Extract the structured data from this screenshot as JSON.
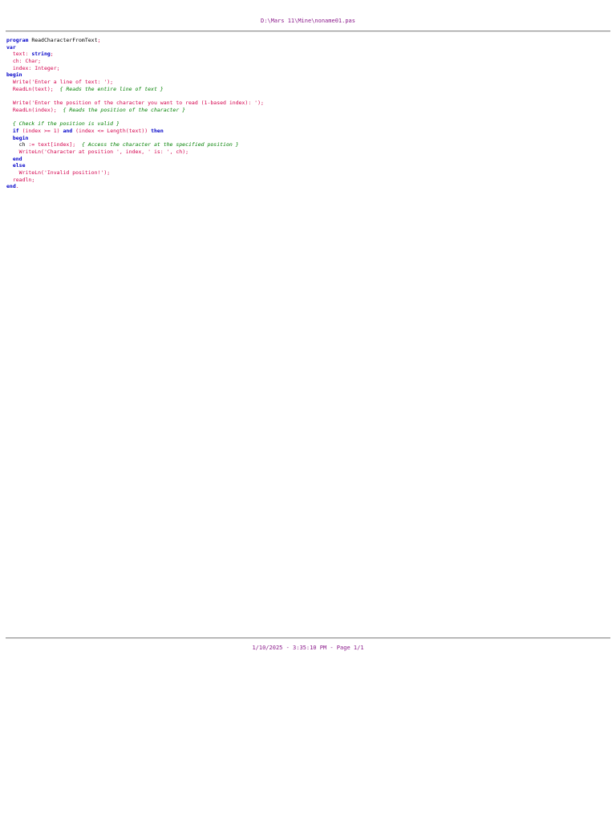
{
  "header": {
    "file_path": "D:\\Mars 11\\Mine\\noname01.pas"
  },
  "code": {
    "lines": [
      [
        {
          "t": "program",
          "c": "kw"
        },
        {
          "t": " ReadCharacterFromText",
          "c": "id"
        },
        {
          "t": ";",
          "c": "sym"
        }
      ],
      [
        {
          "t": "var",
          "c": "kw"
        }
      ],
      [
        {
          "t": "  text",
          "c": "var"
        },
        {
          "t": ": ",
          "c": "sym"
        },
        {
          "t": "string",
          "c": "kw"
        },
        {
          "t": ";",
          "c": "sym"
        }
      ],
      [
        {
          "t": "  ch",
          "c": "var"
        },
        {
          "t": ": ",
          "c": "sym"
        },
        {
          "t": "Char",
          "c": "fn"
        },
        {
          "t": ";",
          "c": "sym"
        }
      ],
      [
        {
          "t": "  index",
          "c": "var"
        },
        {
          "t": ": ",
          "c": "sym"
        },
        {
          "t": "Integer",
          "c": "fn"
        },
        {
          "t": ";",
          "c": "sym"
        }
      ],
      [
        {
          "t": "begin",
          "c": "kw"
        }
      ],
      [
        {
          "t": "  Write",
          "c": "fn"
        },
        {
          "t": "(",
          "c": "sym"
        },
        {
          "t": "'Enter a line of text: '",
          "c": "str"
        },
        {
          "t": ");",
          "c": "sym"
        }
      ],
      [
        {
          "t": "  ReadLn",
          "c": "fn"
        },
        {
          "t": "(",
          "c": "sym"
        },
        {
          "t": "text",
          "c": "var"
        },
        {
          "t": ");",
          "c": "sym"
        },
        {
          "t": "  { Reads the entire line of text }",
          "c": "cm"
        }
      ],
      [],
      [
        {
          "t": "  Write",
          "c": "fn"
        },
        {
          "t": "(",
          "c": "sym"
        },
        {
          "t": "'Enter the position of the character you want to read (1-based index): '",
          "c": "str"
        },
        {
          "t": ");",
          "c": "sym"
        }
      ],
      [
        {
          "t": "  ReadLn",
          "c": "fn"
        },
        {
          "t": "(",
          "c": "sym"
        },
        {
          "t": "index",
          "c": "var"
        },
        {
          "t": ");",
          "c": "sym"
        },
        {
          "t": "  { Reads the position of the character }",
          "c": "cm"
        }
      ],
      [],
      [
        {
          "t": "  { Check if the position is valid }",
          "c": "cm"
        }
      ],
      [
        {
          "t": "  if",
          "c": "kw"
        },
        {
          "t": " (",
          "c": "sym"
        },
        {
          "t": "index",
          "c": "var"
        },
        {
          "t": " >= ",
          "c": "sym"
        },
        {
          "t": "1",
          "c": "num"
        },
        {
          "t": ") ",
          "c": "sym"
        },
        {
          "t": "and",
          "c": "kw"
        },
        {
          "t": " (",
          "c": "sym"
        },
        {
          "t": "index",
          "c": "var"
        },
        {
          "t": " <= ",
          "c": "sym"
        },
        {
          "t": "Length",
          "c": "fn"
        },
        {
          "t": "(",
          "c": "sym"
        },
        {
          "t": "text",
          "c": "var"
        },
        {
          "t": ")) ",
          "c": "sym"
        },
        {
          "t": "then",
          "c": "kw"
        }
      ],
      [
        {
          "t": "  begin",
          "c": "kw"
        }
      ],
      [
        {
          "t": "    ch",
          "c": "id"
        },
        {
          "t": " := ",
          "c": "sym"
        },
        {
          "t": "text",
          "c": "var"
        },
        {
          "t": "[",
          "c": "sym"
        },
        {
          "t": "index",
          "c": "var"
        },
        {
          "t": "];",
          "c": "sym"
        },
        {
          "t": "  { Access the character at the specified position }",
          "c": "cm"
        }
      ],
      [
        {
          "t": "    WriteLn",
          "c": "fn"
        },
        {
          "t": "(",
          "c": "sym"
        },
        {
          "t": "'Character at position '",
          "c": "str"
        },
        {
          "t": ", ",
          "c": "sym"
        },
        {
          "t": "index",
          "c": "var"
        },
        {
          "t": ", ",
          "c": "sym"
        },
        {
          "t": "' is: '",
          "c": "str"
        },
        {
          "t": ", ",
          "c": "sym"
        },
        {
          "t": "ch",
          "c": "var"
        },
        {
          "t": ");",
          "c": "sym"
        }
      ],
      [
        {
          "t": "  end",
          "c": "kw"
        }
      ],
      [
        {
          "t": "  else",
          "c": "kw"
        }
      ],
      [
        {
          "t": "    WriteLn",
          "c": "fn"
        },
        {
          "t": "(",
          "c": "sym"
        },
        {
          "t": "'Invalid position!'",
          "c": "str"
        },
        {
          "t": ");",
          "c": "sym"
        }
      ],
      [
        {
          "t": "  readln",
          "c": "fn"
        },
        {
          "t": ";",
          "c": "sym"
        }
      ],
      [
        {
          "t": "end",
          "c": "kw"
        },
        {
          "t": ".",
          "c": "sym"
        }
      ]
    ]
  },
  "footer": {
    "print_info": "1/10/2025 - 3:35:10 PM - Page 1/1"
  }
}
